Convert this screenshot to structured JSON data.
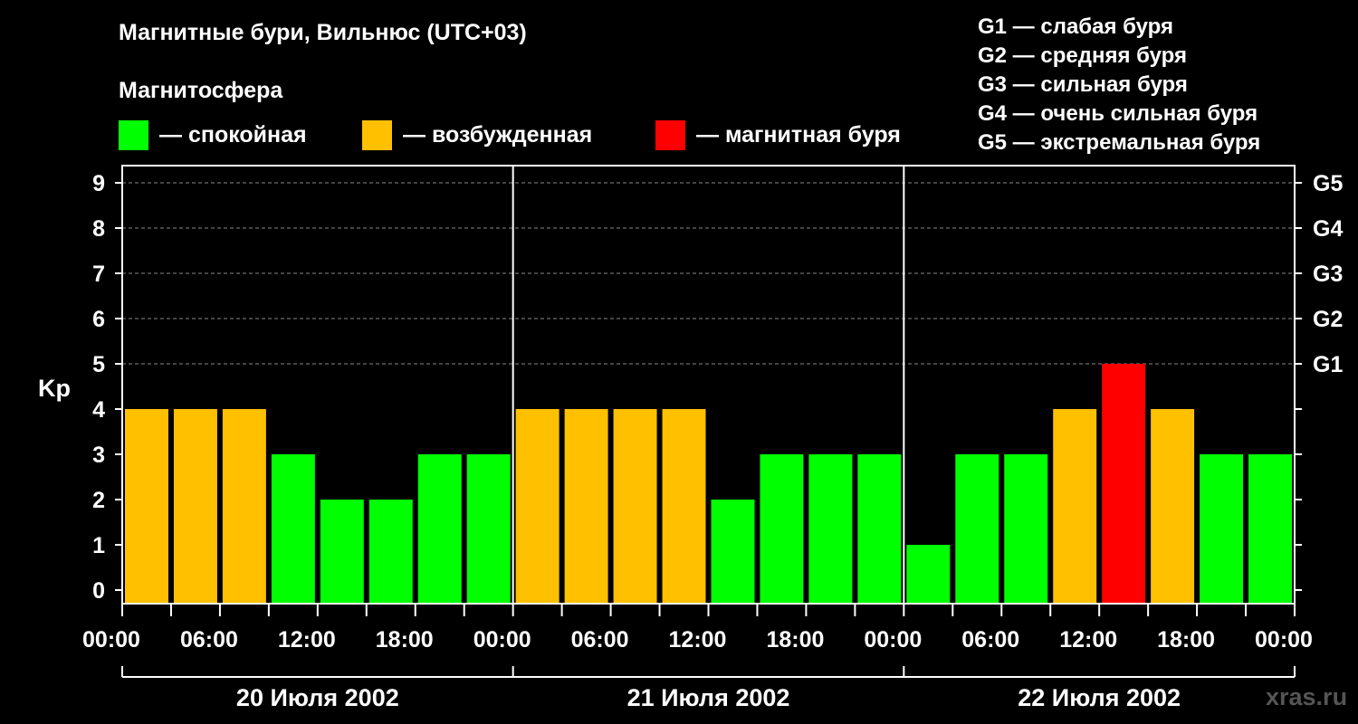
{
  "header": {
    "title": "Магнитные бури, Вильнюс (UTC+03)",
    "subtitle": "Магнитосфера"
  },
  "legend": [
    {
      "color": "#00ff00",
      "label": "— спокойная"
    },
    {
      "color": "#ffc000",
      "label": "— возбужденная"
    },
    {
      "color": "#ff0000",
      "label": "— магнитная буря"
    }
  ],
  "storm_scale": [
    "G1 — слабая буря",
    "G2 — средняя буря",
    "G3 — сильная буря",
    "G4 — очень сильная буря",
    "G5 — экстремальная буря"
  ],
  "watermark": "xras.ru",
  "chart_data": {
    "type": "bar",
    "ylabel": "Kp",
    "ylim": [
      0,
      9
    ],
    "yticks": [
      0,
      1,
      2,
      3,
      4,
      5,
      6,
      7,
      8,
      9
    ],
    "right_axis_ticks": [
      {
        "value": 5,
        "label": "G1"
      },
      {
        "value": 6,
        "label": "G2"
      },
      {
        "value": 7,
        "label": "G3"
      },
      {
        "value": 8,
        "label": "G4"
      },
      {
        "value": 9,
        "label": "G5"
      }
    ],
    "grid": "dashed horizontal at 5–9",
    "x_tick_labels": [
      "00:00",
      "06:00",
      "12:00",
      "18:00",
      "00:00",
      "06:00",
      "12:00",
      "18:00",
      "00:00",
      "06:00",
      "12:00",
      "18:00",
      "00:00"
    ],
    "days": [
      "20 Июля 2002",
      "21 Июля 2002",
      "22 Июля 2002"
    ],
    "bars_per_day": 8,
    "colors": {
      "quiet": "#00ff00",
      "active": "#ffc000",
      "storm": "#ff0000"
    },
    "values": [
      4,
      4,
      4,
      3,
      2,
      2,
      3,
      3,
      4,
      4,
      4,
      4,
      2,
      3,
      3,
      3,
      1,
      3,
      3,
      4,
      5,
      4,
      3,
      3
    ]
  }
}
